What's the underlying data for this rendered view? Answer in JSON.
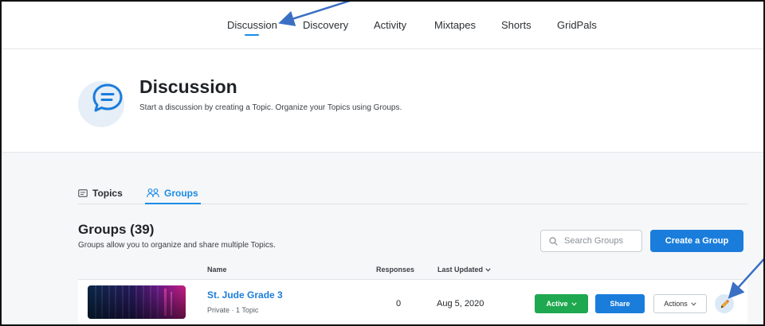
{
  "nav": {
    "items": [
      {
        "label": "Discussion",
        "active": true
      },
      {
        "label": "Discovery"
      },
      {
        "label": "Activity"
      },
      {
        "label": "Mixtapes"
      },
      {
        "label": "Shorts"
      },
      {
        "label": "GridPals"
      }
    ]
  },
  "header": {
    "title": "Discussion",
    "subtitle": "Start a discussion by creating a Topic. Organize your Topics using Groups.",
    "icon": "chat-bubble-icon"
  },
  "tabs": {
    "topics": "Topics",
    "groups": "Groups",
    "active": "groups"
  },
  "groups": {
    "title": "Groups (39)",
    "description": "Groups allow you to organize and share multiple Topics.",
    "search_placeholder": "Search Groups",
    "create_label": "Create a Group"
  },
  "table": {
    "columns": {
      "name": "Name",
      "responses": "Responses",
      "last_updated": "Last Updated"
    },
    "rows": [
      {
        "name": "St. Jude Grade 3",
        "meta": "Private · 1 Topic",
        "responses": "0",
        "updated": "Aug 5, 2020",
        "status": "Active",
        "share": "Share",
        "actions": "Actions"
      }
    ]
  },
  "colors": {
    "accent": "#1a7ddb",
    "active_green": "#1ea84f",
    "annotation_arrow": "#3b6fc4"
  }
}
